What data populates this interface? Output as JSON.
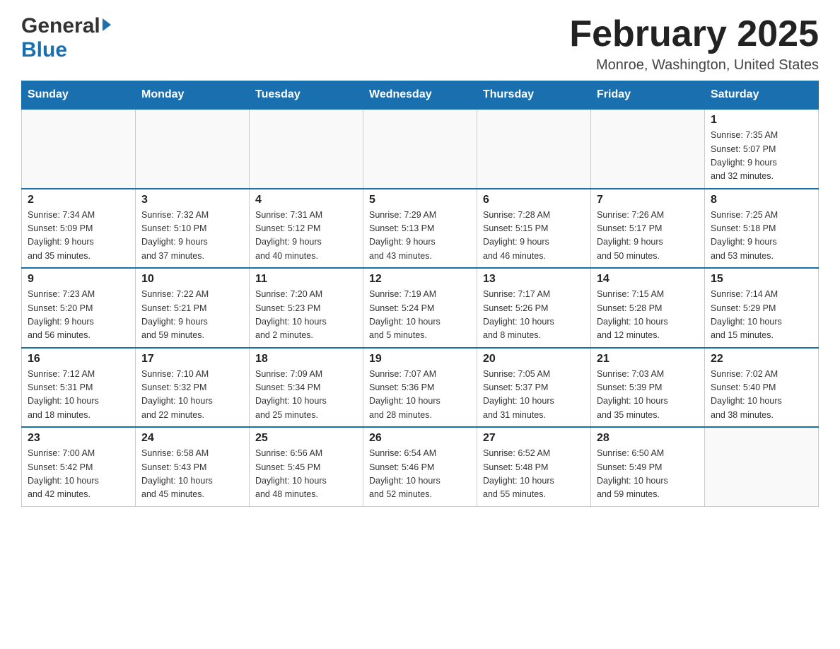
{
  "header": {
    "month_title": "February 2025",
    "location": "Monroe, Washington, United States",
    "logo_general": "General",
    "logo_blue": "Blue"
  },
  "days_of_week": [
    "Sunday",
    "Monday",
    "Tuesday",
    "Wednesday",
    "Thursday",
    "Friday",
    "Saturday"
  ],
  "weeks": [
    [
      {
        "day": "",
        "info": ""
      },
      {
        "day": "",
        "info": ""
      },
      {
        "day": "",
        "info": ""
      },
      {
        "day": "",
        "info": ""
      },
      {
        "day": "",
        "info": ""
      },
      {
        "day": "",
        "info": ""
      },
      {
        "day": "1",
        "info": "Sunrise: 7:35 AM\nSunset: 5:07 PM\nDaylight: 9 hours\nand 32 minutes."
      }
    ],
    [
      {
        "day": "2",
        "info": "Sunrise: 7:34 AM\nSunset: 5:09 PM\nDaylight: 9 hours\nand 35 minutes."
      },
      {
        "day": "3",
        "info": "Sunrise: 7:32 AM\nSunset: 5:10 PM\nDaylight: 9 hours\nand 37 minutes."
      },
      {
        "day": "4",
        "info": "Sunrise: 7:31 AM\nSunset: 5:12 PM\nDaylight: 9 hours\nand 40 minutes."
      },
      {
        "day": "5",
        "info": "Sunrise: 7:29 AM\nSunset: 5:13 PM\nDaylight: 9 hours\nand 43 minutes."
      },
      {
        "day": "6",
        "info": "Sunrise: 7:28 AM\nSunset: 5:15 PM\nDaylight: 9 hours\nand 46 minutes."
      },
      {
        "day": "7",
        "info": "Sunrise: 7:26 AM\nSunset: 5:17 PM\nDaylight: 9 hours\nand 50 minutes."
      },
      {
        "day": "8",
        "info": "Sunrise: 7:25 AM\nSunset: 5:18 PM\nDaylight: 9 hours\nand 53 minutes."
      }
    ],
    [
      {
        "day": "9",
        "info": "Sunrise: 7:23 AM\nSunset: 5:20 PM\nDaylight: 9 hours\nand 56 minutes."
      },
      {
        "day": "10",
        "info": "Sunrise: 7:22 AM\nSunset: 5:21 PM\nDaylight: 9 hours\nand 59 minutes."
      },
      {
        "day": "11",
        "info": "Sunrise: 7:20 AM\nSunset: 5:23 PM\nDaylight: 10 hours\nand 2 minutes."
      },
      {
        "day": "12",
        "info": "Sunrise: 7:19 AM\nSunset: 5:24 PM\nDaylight: 10 hours\nand 5 minutes."
      },
      {
        "day": "13",
        "info": "Sunrise: 7:17 AM\nSunset: 5:26 PM\nDaylight: 10 hours\nand 8 minutes."
      },
      {
        "day": "14",
        "info": "Sunrise: 7:15 AM\nSunset: 5:28 PM\nDaylight: 10 hours\nand 12 minutes."
      },
      {
        "day": "15",
        "info": "Sunrise: 7:14 AM\nSunset: 5:29 PM\nDaylight: 10 hours\nand 15 minutes."
      }
    ],
    [
      {
        "day": "16",
        "info": "Sunrise: 7:12 AM\nSunset: 5:31 PM\nDaylight: 10 hours\nand 18 minutes."
      },
      {
        "day": "17",
        "info": "Sunrise: 7:10 AM\nSunset: 5:32 PM\nDaylight: 10 hours\nand 22 minutes."
      },
      {
        "day": "18",
        "info": "Sunrise: 7:09 AM\nSunset: 5:34 PM\nDaylight: 10 hours\nand 25 minutes."
      },
      {
        "day": "19",
        "info": "Sunrise: 7:07 AM\nSunset: 5:36 PM\nDaylight: 10 hours\nand 28 minutes."
      },
      {
        "day": "20",
        "info": "Sunrise: 7:05 AM\nSunset: 5:37 PM\nDaylight: 10 hours\nand 31 minutes."
      },
      {
        "day": "21",
        "info": "Sunrise: 7:03 AM\nSunset: 5:39 PM\nDaylight: 10 hours\nand 35 minutes."
      },
      {
        "day": "22",
        "info": "Sunrise: 7:02 AM\nSunset: 5:40 PM\nDaylight: 10 hours\nand 38 minutes."
      }
    ],
    [
      {
        "day": "23",
        "info": "Sunrise: 7:00 AM\nSunset: 5:42 PM\nDaylight: 10 hours\nand 42 minutes."
      },
      {
        "day": "24",
        "info": "Sunrise: 6:58 AM\nSunset: 5:43 PM\nDaylight: 10 hours\nand 45 minutes."
      },
      {
        "day": "25",
        "info": "Sunrise: 6:56 AM\nSunset: 5:45 PM\nDaylight: 10 hours\nand 48 minutes."
      },
      {
        "day": "26",
        "info": "Sunrise: 6:54 AM\nSunset: 5:46 PM\nDaylight: 10 hours\nand 52 minutes."
      },
      {
        "day": "27",
        "info": "Sunrise: 6:52 AM\nSunset: 5:48 PM\nDaylight: 10 hours\nand 55 minutes."
      },
      {
        "day": "28",
        "info": "Sunrise: 6:50 AM\nSunset: 5:49 PM\nDaylight: 10 hours\nand 59 minutes."
      },
      {
        "day": "",
        "info": ""
      }
    ]
  ]
}
